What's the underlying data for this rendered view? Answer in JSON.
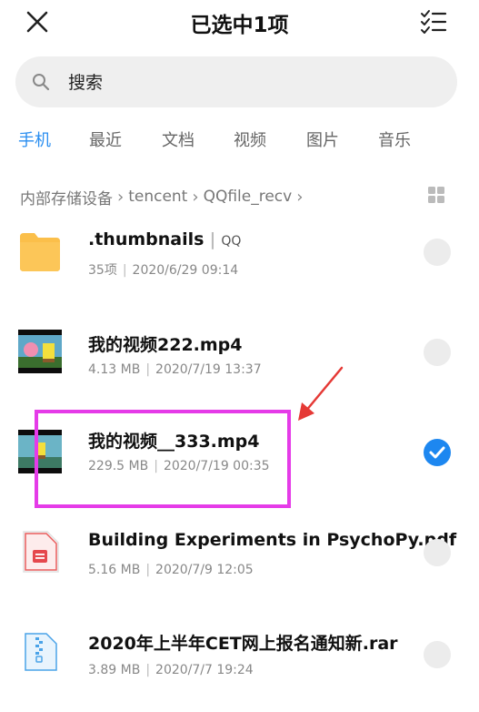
{
  "header": {
    "title": "已选中1项"
  },
  "search": {
    "placeholder": "搜索"
  },
  "tabs": [
    {
      "label": "手机",
      "active": true
    },
    {
      "label": "最近"
    },
    {
      "label": "文档"
    },
    {
      "label": "视频"
    },
    {
      "label": "图片"
    },
    {
      "label": "音乐"
    }
  ],
  "breadcrumb": [
    "内部存储设备",
    "tencent",
    "QQfile_recv"
  ],
  "files": [
    {
      "name": ".thumbnails",
      "tag": "QQ",
      "size": "35项",
      "date": "2020/6/29 09:14",
      "icon": "folder-icon",
      "selected": false
    },
    {
      "name": "我的视频222.mp4",
      "size": "4.13 MB",
      "date": "2020/7/19 13:37",
      "icon": "video-thumbnail",
      "selected": false
    },
    {
      "name": "我的视频__333.mp4",
      "size": "229.5 MB",
      "date": "2020/7/19 00:35",
      "icon": "video-thumbnail",
      "selected": true
    },
    {
      "name": "Building Experiments in PsychoPy.pdf",
      "size": "5.16 MB",
      "date": "2020/7/9 12:05",
      "icon": "pdf-icon",
      "selected": false
    },
    {
      "name": "2020年上半年CET网上报名通知新.rar",
      "size": "3.89 MB",
      "date": "2020/7/7 19:24",
      "icon": "archive-icon",
      "selected": false
    }
  ],
  "colors": {
    "accent": "#1d87f0",
    "highlight": "#e53be8",
    "arrow": "#e53935",
    "folder": "#fbbf4a"
  }
}
